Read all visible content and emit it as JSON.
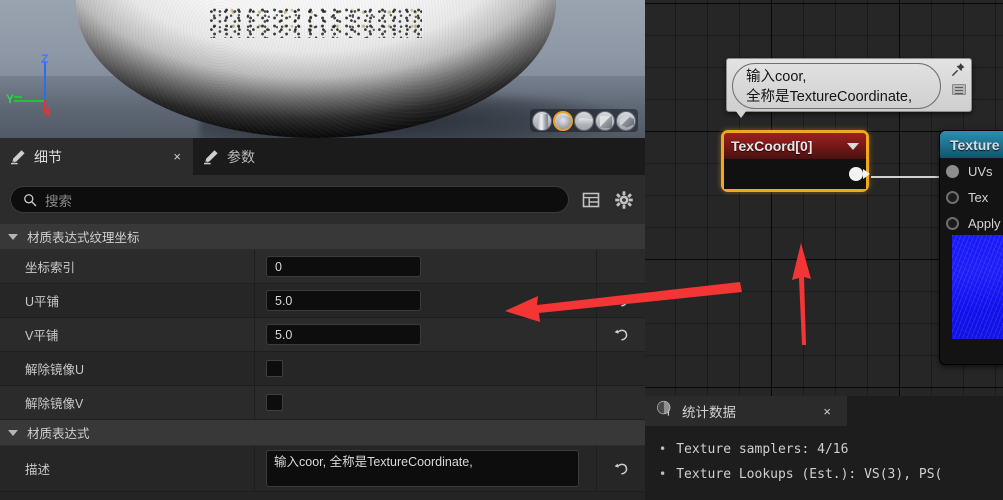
{
  "viewport": {
    "gizmo": {
      "z": "Z",
      "y": "Y",
      "x": "X"
    },
    "shape_buttons": [
      "cylinder-preview",
      "sphere-preview",
      "plane-preview",
      "cube-preview",
      "custom-mesh-preview"
    ],
    "selected_shape": "sphere-preview"
  },
  "details_panel": {
    "tabs": [
      {
        "label": "细节",
        "icon": "pen-icon",
        "active": true,
        "close": "×"
      },
      {
        "label": "参数",
        "icon": "pen-icon",
        "active": false
      }
    ],
    "search": {
      "placeholder": "搜索",
      "icon": "search-icon"
    },
    "toolbar_icons": [
      "table-view-icon",
      "gear-icon"
    ],
    "categories": [
      {
        "label": "材质表达式纹理坐标",
        "expanded": true,
        "rows": [
          {
            "name": "坐标索引",
            "type": "number",
            "value": "0",
            "revert": false
          },
          {
            "name": "U平铺",
            "type": "number",
            "value": "5.0",
            "revert": true
          },
          {
            "name": "V平铺",
            "type": "number",
            "value": "5.0",
            "revert": true
          },
          {
            "name": "解除镜像U",
            "type": "checkbox",
            "value": "",
            "checked": false,
            "revert": false
          },
          {
            "name": "解除镜像V",
            "type": "checkbox",
            "value": "",
            "checked": false,
            "revert": false
          }
        ]
      },
      {
        "label": "材质表达式",
        "expanded": true,
        "rows": [
          {
            "name": "描述",
            "type": "textarea",
            "value": "输入coor,\n全称是TextureCoordinate,",
            "revert": true
          }
        ]
      }
    ]
  },
  "graph": {
    "tooltip": {
      "text": "输入coor,\n全称是TextureCoordinate,",
      "pin_icon": "pin-icon",
      "resize_icon": "mini-panel-icon"
    },
    "nodes": [
      {
        "title": "TexCoord[0]",
        "accent": "#f0a81e",
        "header_color": "#6d1717",
        "selected": true,
        "dropdown_icon": "chevron-down-icon",
        "output_pin": "output-pin"
      },
      {
        "title": "Texture",
        "header_color": "#1c6c8a",
        "pins": [
          {
            "label": "UVs",
            "state": "connected"
          },
          {
            "label": "Tex",
            "state": "empty"
          },
          {
            "label": "Apply",
            "state": "empty"
          }
        ],
        "preview_color": "#1a1aff"
      }
    ],
    "annotations": [
      {
        "type": "arrow",
        "name": "horizontal-callout-arrow",
        "color": "#f03030"
      },
      {
        "type": "arrow",
        "name": "vertical-callout-arrow",
        "color": "#f03030"
      }
    ]
  },
  "stats_panel": {
    "title": "统计数据",
    "icon": "stats-info-icon",
    "close": "×",
    "lines": [
      {
        "bullet": "•",
        "text": "Texture samplers: 4/16"
      },
      {
        "bullet": "•",
        "text": "Texture Lookups (Est.): VS(3), PS("
      }
    ]
  }
}
